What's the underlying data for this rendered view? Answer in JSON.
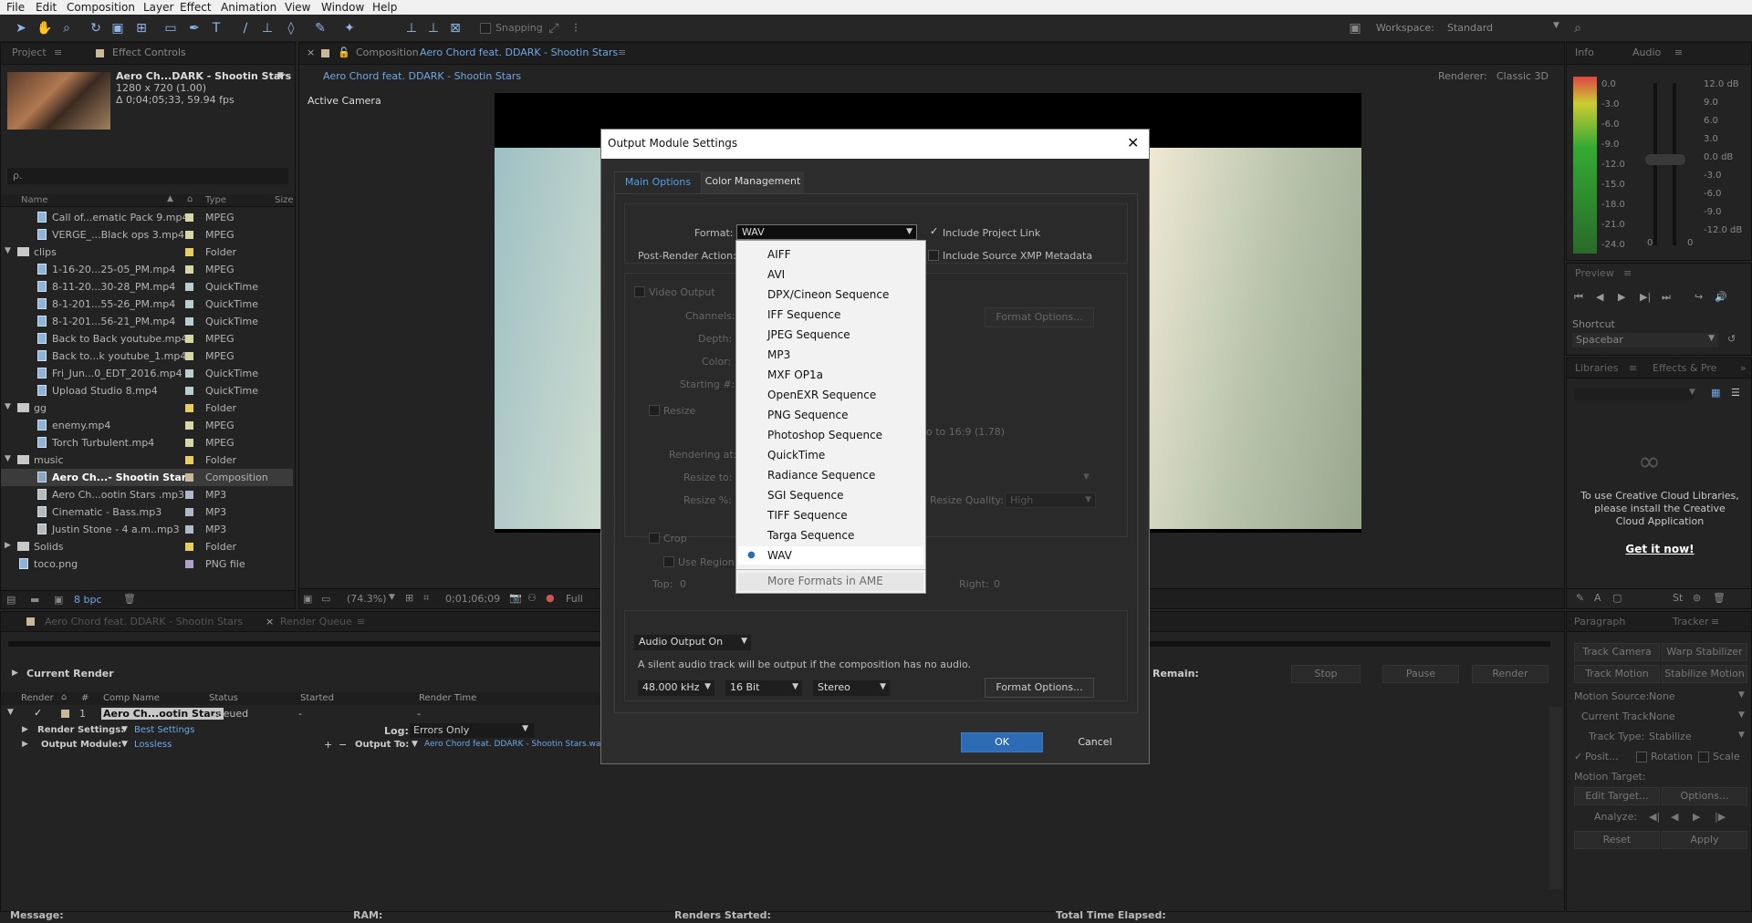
{
  "menu": [
    "File",
    "Edit",
    "Composition",
    "Layer",
    "Effect",
    "Animation",
    "View",
    "Window",
    "Help"
  ],
  "toolbar": {
    "snapping": "Snapping",
    "workspace_label": "Workspace:",
    "workspace_value": "Standard"
  },
  "project": {
    "tab_project": "Project",
    "tab_effect_controls": "Effect Controls",
    "comp_name": "Aero Ch...DARK - Shootin Stars",
    "comp_res": "1280 x 720 (1.00)",
    "comp_dur": "Δ 0;04;05;33, 59.94 fps",
    "search_placeholder": "ρ.",
    "col_name": "Name",
    "col_type": "Type",
    "col_size": "Size",
    "rows": [
      {
        "name": "Call of...ematic Pack 9.mp4",
        "type": "MPEG",
        "kind": "file",
        "indent": 1,
        "color": "#d6d6a6"
      },
      {
        "name": "VERGE_...Black ops 3.mp4",
        "type": "MPEG",
        "kind": "file",
        "indent": 1,
        "color": "#d6d6a6"
      },
      {
        "name": "clips",
        "type": "Folder",
        "kind": "folder",
        "indent": 0,
        "color": "#e6cf5c"
      },
      {
        "name": "1-16-20...25-05_PM.mp4",
        "type": "MPEG",
        "kind": "file",
        "indent": 1,
        "color": "#d6d6a6"
      },
      {
        "name": "8-11-20...30-28_PM.mp4",
        "type": "QuickTime",
        "kind": "file",
        "indent": 1,
        "color": "#b8cfcf"
      },
      {
        "name": "8-1-201...55-26_PM.mp4",
        "type": "QuickTime",
        "kind": "file",
        "indent": 1,
        "color": "#b8cfcf"
      },
      {
        "name": "8-1-201...56-21_PM.mp4",
        "type": "QuickTime",
        "kind": "file",
        "indent": 1,
        "color": "#b8cfcf"
      },
      {
        "name": "Back to Back youtube.mp4",
        "type": "MPEG",
        "kind": "file",
        "indent": 1,
        "color": "#d6d6a6"
      },
      {
        "name": "Back to...k youtube_1.mp4",
        "type": "MPEG",
        "kind": "file",
        "indent": 1,
        "color": "#d6d6a6"
      },
      {
        "name": "Fri_Jun...0_EDT_2016.mp4",
        "type": "QuickTime",
        "kind": "file",
        "indent": 1,
        "color": "#b8cfcf"
      },
      {
        "name": "Upload Studio 8.mp4",
        "type": "QuickTime",
        "kind": "file",
        "indent": 1,
        "color": "#b8cfcf"
      },
      {
        "name": "gg",
        "type": "Folder",
        "kind": "folder",
        "indent": 0,
        "color": "#e6cf5c"
      },
      {
        "name": "enemy.mp4",
        "type": "MPEG",
        "kind": "file",
        "indent": 1,
        "color": "#d6d6a6"
      },
      {
        "name": "Torch Turbulent.mp4",
        "type": "MPEG",
        "kind": "file",
        "indent": 1,
        "color": "#d6d6a6"
      },
      {
        "name": "music",
        "type": "Folder",
        "kind": "folder",
        "indent": 0,
        "color": "#e6cf5c"
      },
      {
        "name": "Aero Ch...- Shootin Stars",
        "type": "Composition",
        "kind": "comp",
        "indent": 1,
        "color": "#c9b99a"
      },
      {
        "name": "Aero Ch...ootin Stars .mp3",
        "type": "MP3",
        "kind": "audio",
        "indent": 1,
        "color": "#b0b9c9"
      },
      {
        "name": "Cinematic - Bass.mp3",
        "type": "MP3",
        "kind": "audio",
        "indent": 1,
        "color": "#b0b9c9"
      },
      {
        "name": "Justin Stone - 4 a.m..mp3",
        "type": "MP3",
        "kind": "audio",
        "indent": 1,
        "color": "#b0b9c9"
      },
      {
        "name": "Solids",
        "type": "Folder",
        "kind": "folder",
        "indent": 0,
        "color": "#e6cf5c"
      },
      {
        "name": "toco.png",
        "type": "PNG file",
        "kind": "file",
        "indent": 0,
        "color": "#b0a0c9"
      }
    ],
    "bpc": "8 bpc"
  },
  "comp": {
    "tab_label": "Composition",
    "tab_name": "Aero Chord feat. DDARK - Shootin Stars",
    "sub_tab": "Aero Chord feat. DDARK - Shootin Stars",
    "renderer_label": "Renderer:",
    "renderer_value": "Classic 3D",
    "active_camera": "Active Camera",
    "zoom": "(74.3%)",
    "timecode": "0;01;06;09",
    "res": "Full"
  },
  "info_panel": {
    "tab_info": "Info",
    "tab_audio": "Audio",
    "left_db": [
      "0.0",
      "-3.0",
      "-6.0",
      "-9.0",
      "-12.0",
      "-15.0",
      "-18.0",
      "-21.0",
      "-24.0"
    ],
    "right_db": [
      "12.0 dB",
      "9.0",
      "6.0",
      "3.0",
      "0.0 dB",
      "-3.0",
      "-6.0",
      "-9.0",
      "-12.0 dB"
    ],
    "zero_a": "0",
    "zero_b": "0"
  },
  "preview": {
    "title": "Preview",
    "shortcut_label": "Shortcut",
    "shortcut_value": "Spacebar"
  },
  "libraries": {
    "tab": "Libraries",
    "tab2": "Effects & Pre",
    "msg": "To use Creative Cloud Libraries, please install the Creative Cloud Application",
    "link": "Get it now!"
  },
  "tracker": {
    "tab_paragraph": "Paragraph",
    "tab_tracker": "Tracker",
    "btn_track_camera": "Track Camera",
    "btn_warp": "Warp Stabilizer",
    "btn_track_motion": "Track Motion",
    "btn_stab_motion": "Stabilize Motion",
    "motion_source": "Motion Source:",
    "motion_source_val": "None",
    "current_track": "Current Track:",
    "current_track_val": "None",
    "track_type": "Track Type:",
    "track_type_val": "Stabilize",
    "position": "Posit...",
    "rotation": "Rotation",
    "scale": "Scale",
    "motion_target": "Motion Target:",
    "edit_target": "Edit Target...",
    "options": "Options...",
    "analyze": "Analyze:",
    "reset": "Reset",
    "apply": "Apply"
  },
  "render_queue": {
    "tab_comp": "Aero Chord feat. DDARK - Shootin Stars",
    "tab_rq": "Render Queue",
    "current_render": "Current Render",
    "remain": "Remain:",
    "stop": "Stop",
    "pause": "Pause",
    "render": "Render",
    "col_render": "Render",
    "col_num": "#",
    "col_comp": "Comp Name",
    "col_status": "Status",
    "col_started": "Started",
    "col_time": "Render Time",
    "item_num": "1",
    "item_comp": "Aero Ch...ootin Stars",
    "item_status": "Queued",
    "item_started": "-",
    "item_time": "-",
    "render_settings_label": "Render Settings:",
    "render_settings_val": "Best Settings",
    "log_label": "Log:",
    "log_val": "Errors Only",
    "output_module_label": "Output Module:",
    "output_module_val": "Lossless",
    "output_to_label": "Output To:",
    "output_to_val": "Aero Chord feat. DDARK - Shootin Stars.wav",
    "status_message": "Message:",
    "status_ram": "RAM:",
    "status_renders": "Renders Started:",
    "status_elapsed": "Total Time Elapsed:"
  },
  "dialog": {
    "title": "Output Module Settings",
    "tab_main": "Main Options",
    "tab_color": "Color Management",
    "format_label": "Format:",
    "format_value": "WAV",
    "include_project_link": "Include Project Link",
    "include_xmp": "Include Source XMP Metadata",
    "post_render_label": "Post-Render Action:",
    "video_output": "Video Output",
    "channels": "Channels:",
    "depth": "Depth:",
    "color": "Color:",
    "starting": "Starting #:",
    "format_options_video": "Format Options...",
    "resize": "Resize",
    "lock_ratio": "o to 16:9 (1.78)",
    "rendering_at": "Rendering at:",
    "resize_to": "Resize to:",
    "resize_pct": "Resize %:",
    "resize_quality_label": "Resize Quality:",
    "resize_quality_val": "High",
    "crop": "Crop",
    "use_region": "Use Region",
    "top": "Top:",
    "top_val": "0",
    "right": "Right:",
    "right_val": "0",
    "audio_output": "Audio Output On",
    "audio_note": "A silent audio track will be output if the composition has no audio.",
    "sample_rate": "48.000 kHz",
    "bit_depth": "16 Bit",
    "channels_audio": "Stereo",
    "format_options_audio": "Format Options...",
    "ok": "OK",
    "cancel": "Cancel"
  },
  "format_menu": {
    "items": [
      "AIFF",
      "AVI",
      "DPX/Cineon Sequence",
      "IFF Sequence",
      "JPEG Sequence",
      "MP3",
      "MXF OP1a",
      "OpenEXR Sequence",
      "PNG Sequence",
      "Photoshop Sequence",
      "QuickTime",
      "Radiance Sequence",
      "SGI Sequence",
      "TIFF Sequence",
      "Targa Sequence",
      "WAV"
    ],
    "selected": "WAV",
    "more": "More Formats in AME"
  }
}
